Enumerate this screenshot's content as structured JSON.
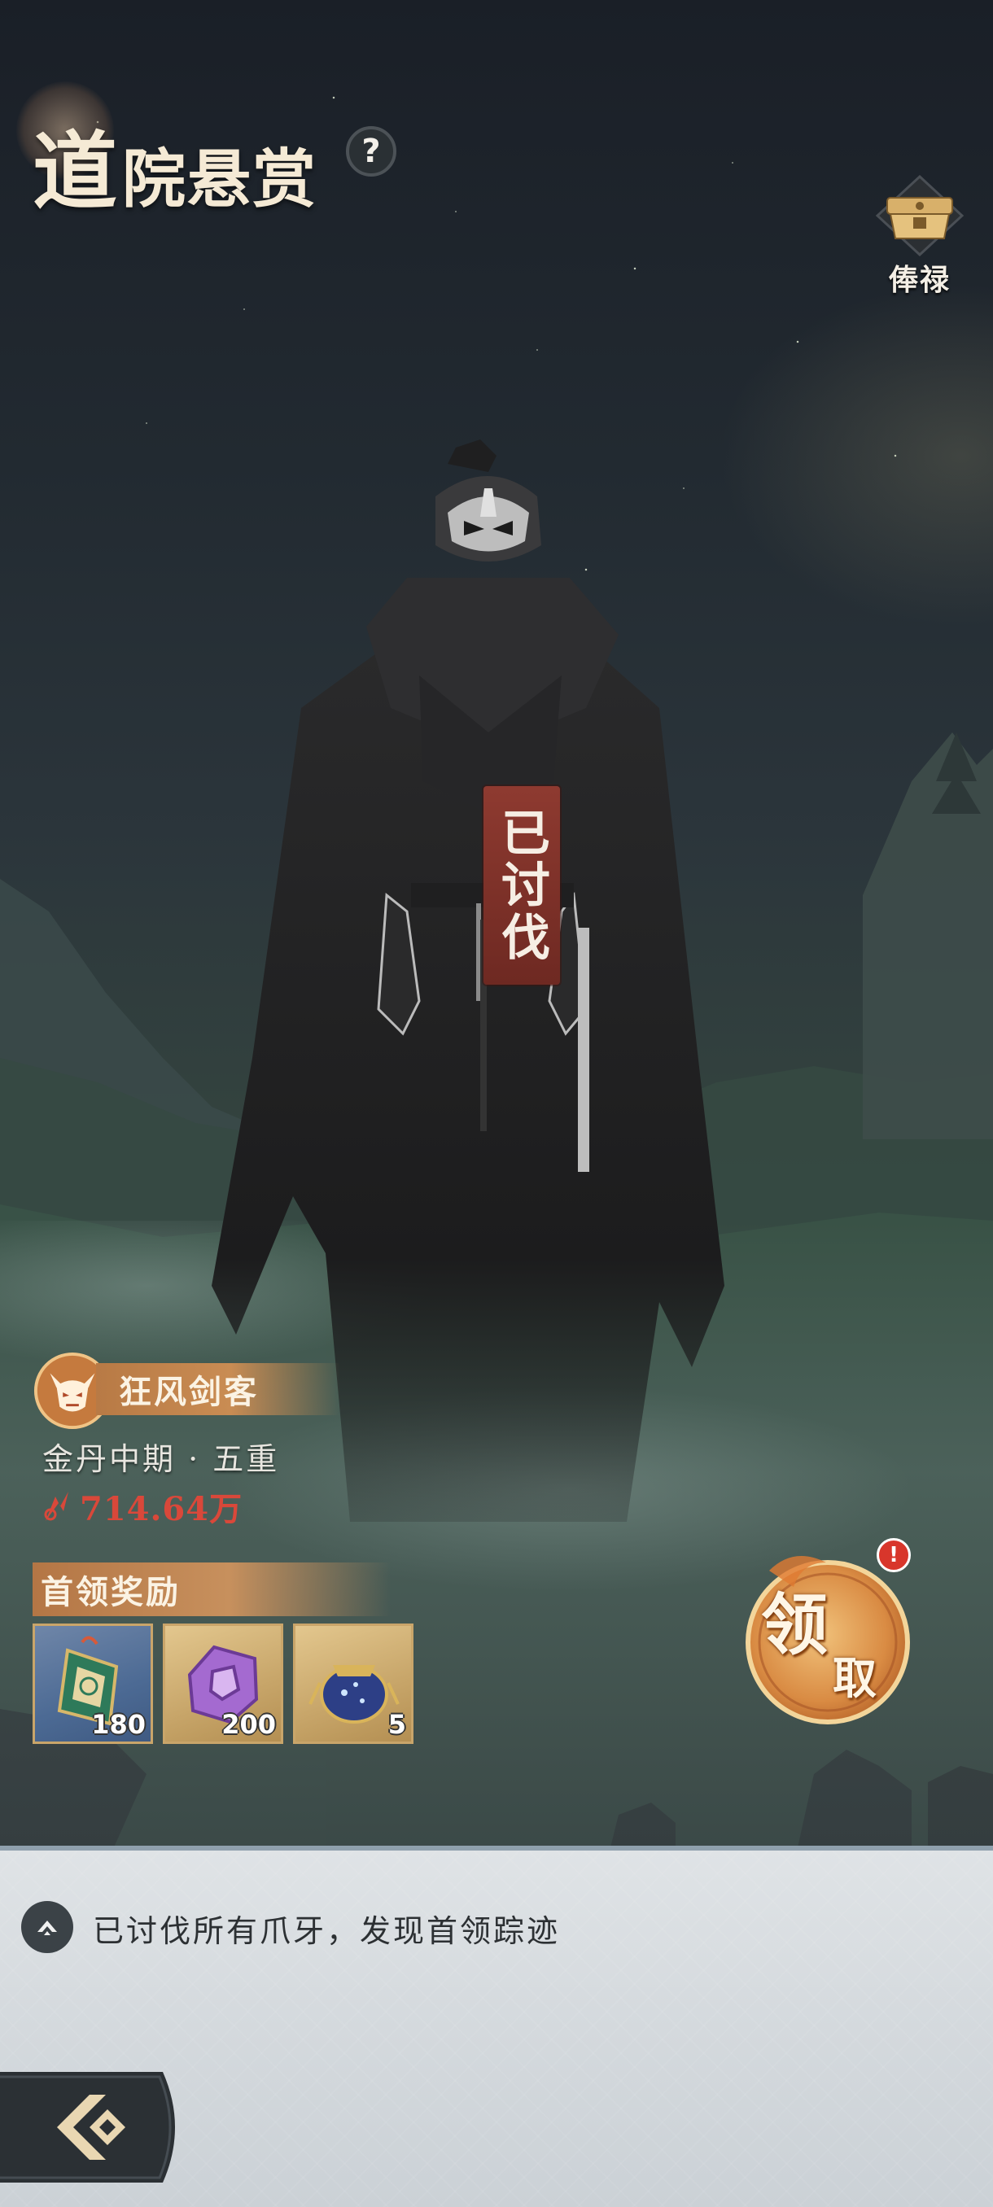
{
  "header": {
    "title_first": "道",
    "title_rest": "院悬赏",
    "help_label": "?",
    "salary_label": "俸禄"
  },
  "boss": {
    "status_stamp": "已讨伐",
    "name": "狂风剑客",
    "realm": "金丹中期 · 五重",
    "power": "714.64万"
  },
  "rewards": {
    "title": "首领奖励",
    "items": [
      {
        "icon": "scroll-talisman-icon",
        "count": "180",
        "frame": "blue"
      },
      {
        "icon": "purple-jade-icon",
        "count": "200",
        "frame": "gold"
      },
      {
        "icon": "treasure-pouch-icon",
        "count": "5",
        "frame": "gold"
      }
    ]
  },
  "claim": {
    "label_big": "领",
    "label_small": "取",
    "badge": "!"
  },
  "message": {
    "text": "已讨伐所有爪牙，发现首领踪迹"
  },
  "colors": {
    "power_red": "#d9483a",
    "gold_accent": "#c98c53",
    "stamp_red": "#8e3a30",
    "panel_bg": "#d4d9dd"
  }
}
